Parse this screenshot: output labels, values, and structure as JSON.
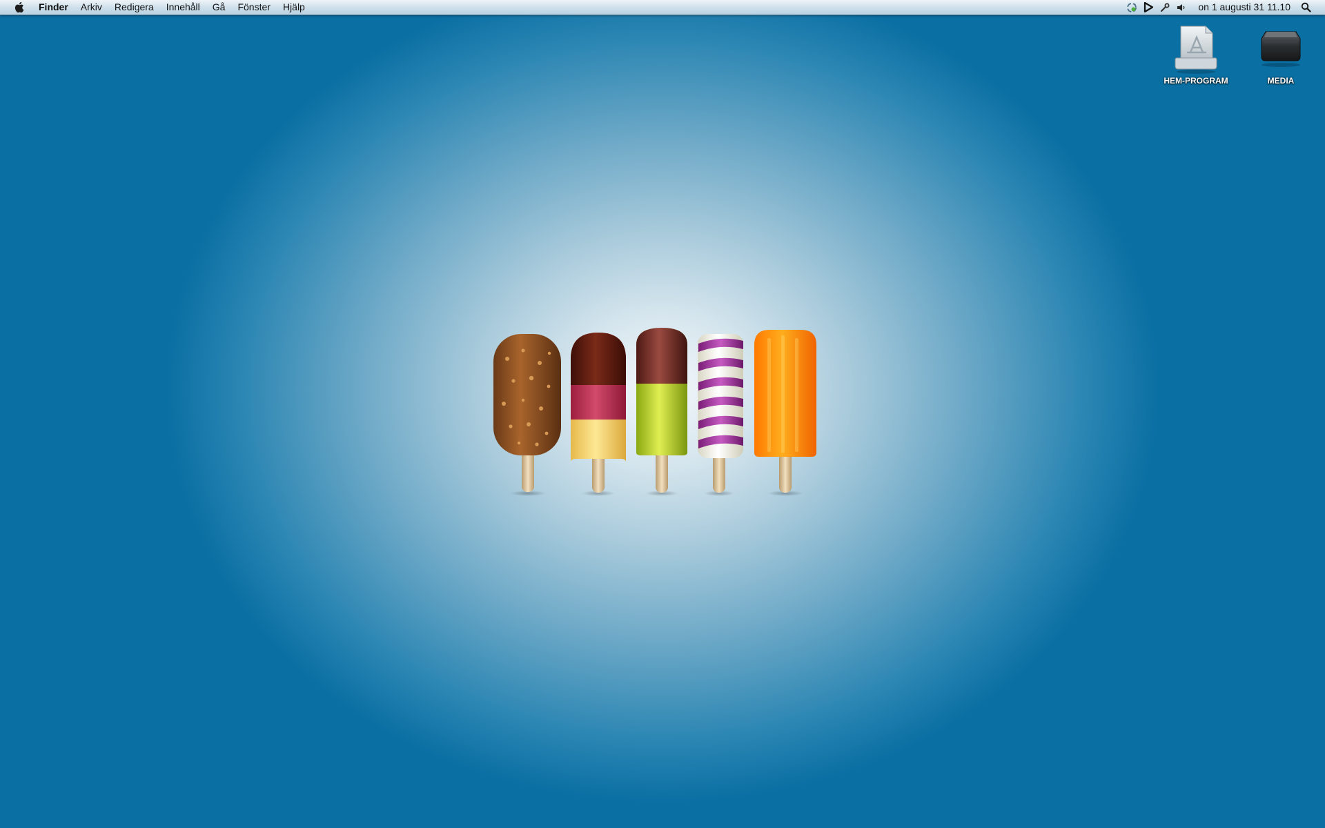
{
  "menubar": {
    "apple_icon": "apple-logo-icon",
    "app_name": "Finder",
    "menus": [
      "Arkiv",
      "Redigera",
      "Innehåll",
      "Gå",
      "Fönster",
      "Hjälp"
    ],
    "status_icons": [
      "sync-icon",
      "play-icon",
      "wrench-icon",
      "volume-icon"
    ],
    "clock": "on 1 augusti 31  11.10",
    "spotlight_icon": "spotlight-search-icon"
  },
  "desktop": {
    "icons": [
      {
        "label": "HEM-PROGRAM",
        "icon": "applications-folder-icon"
      },
      {
        "label": "MEDIA",
        "icon": "external-drive-icon"
      }
    ],
    "wallpaper": {
      "colors": {
        "center": "#f4f8fa",
        "edge": "#0a6fa3"
      }
    }
  }
}
